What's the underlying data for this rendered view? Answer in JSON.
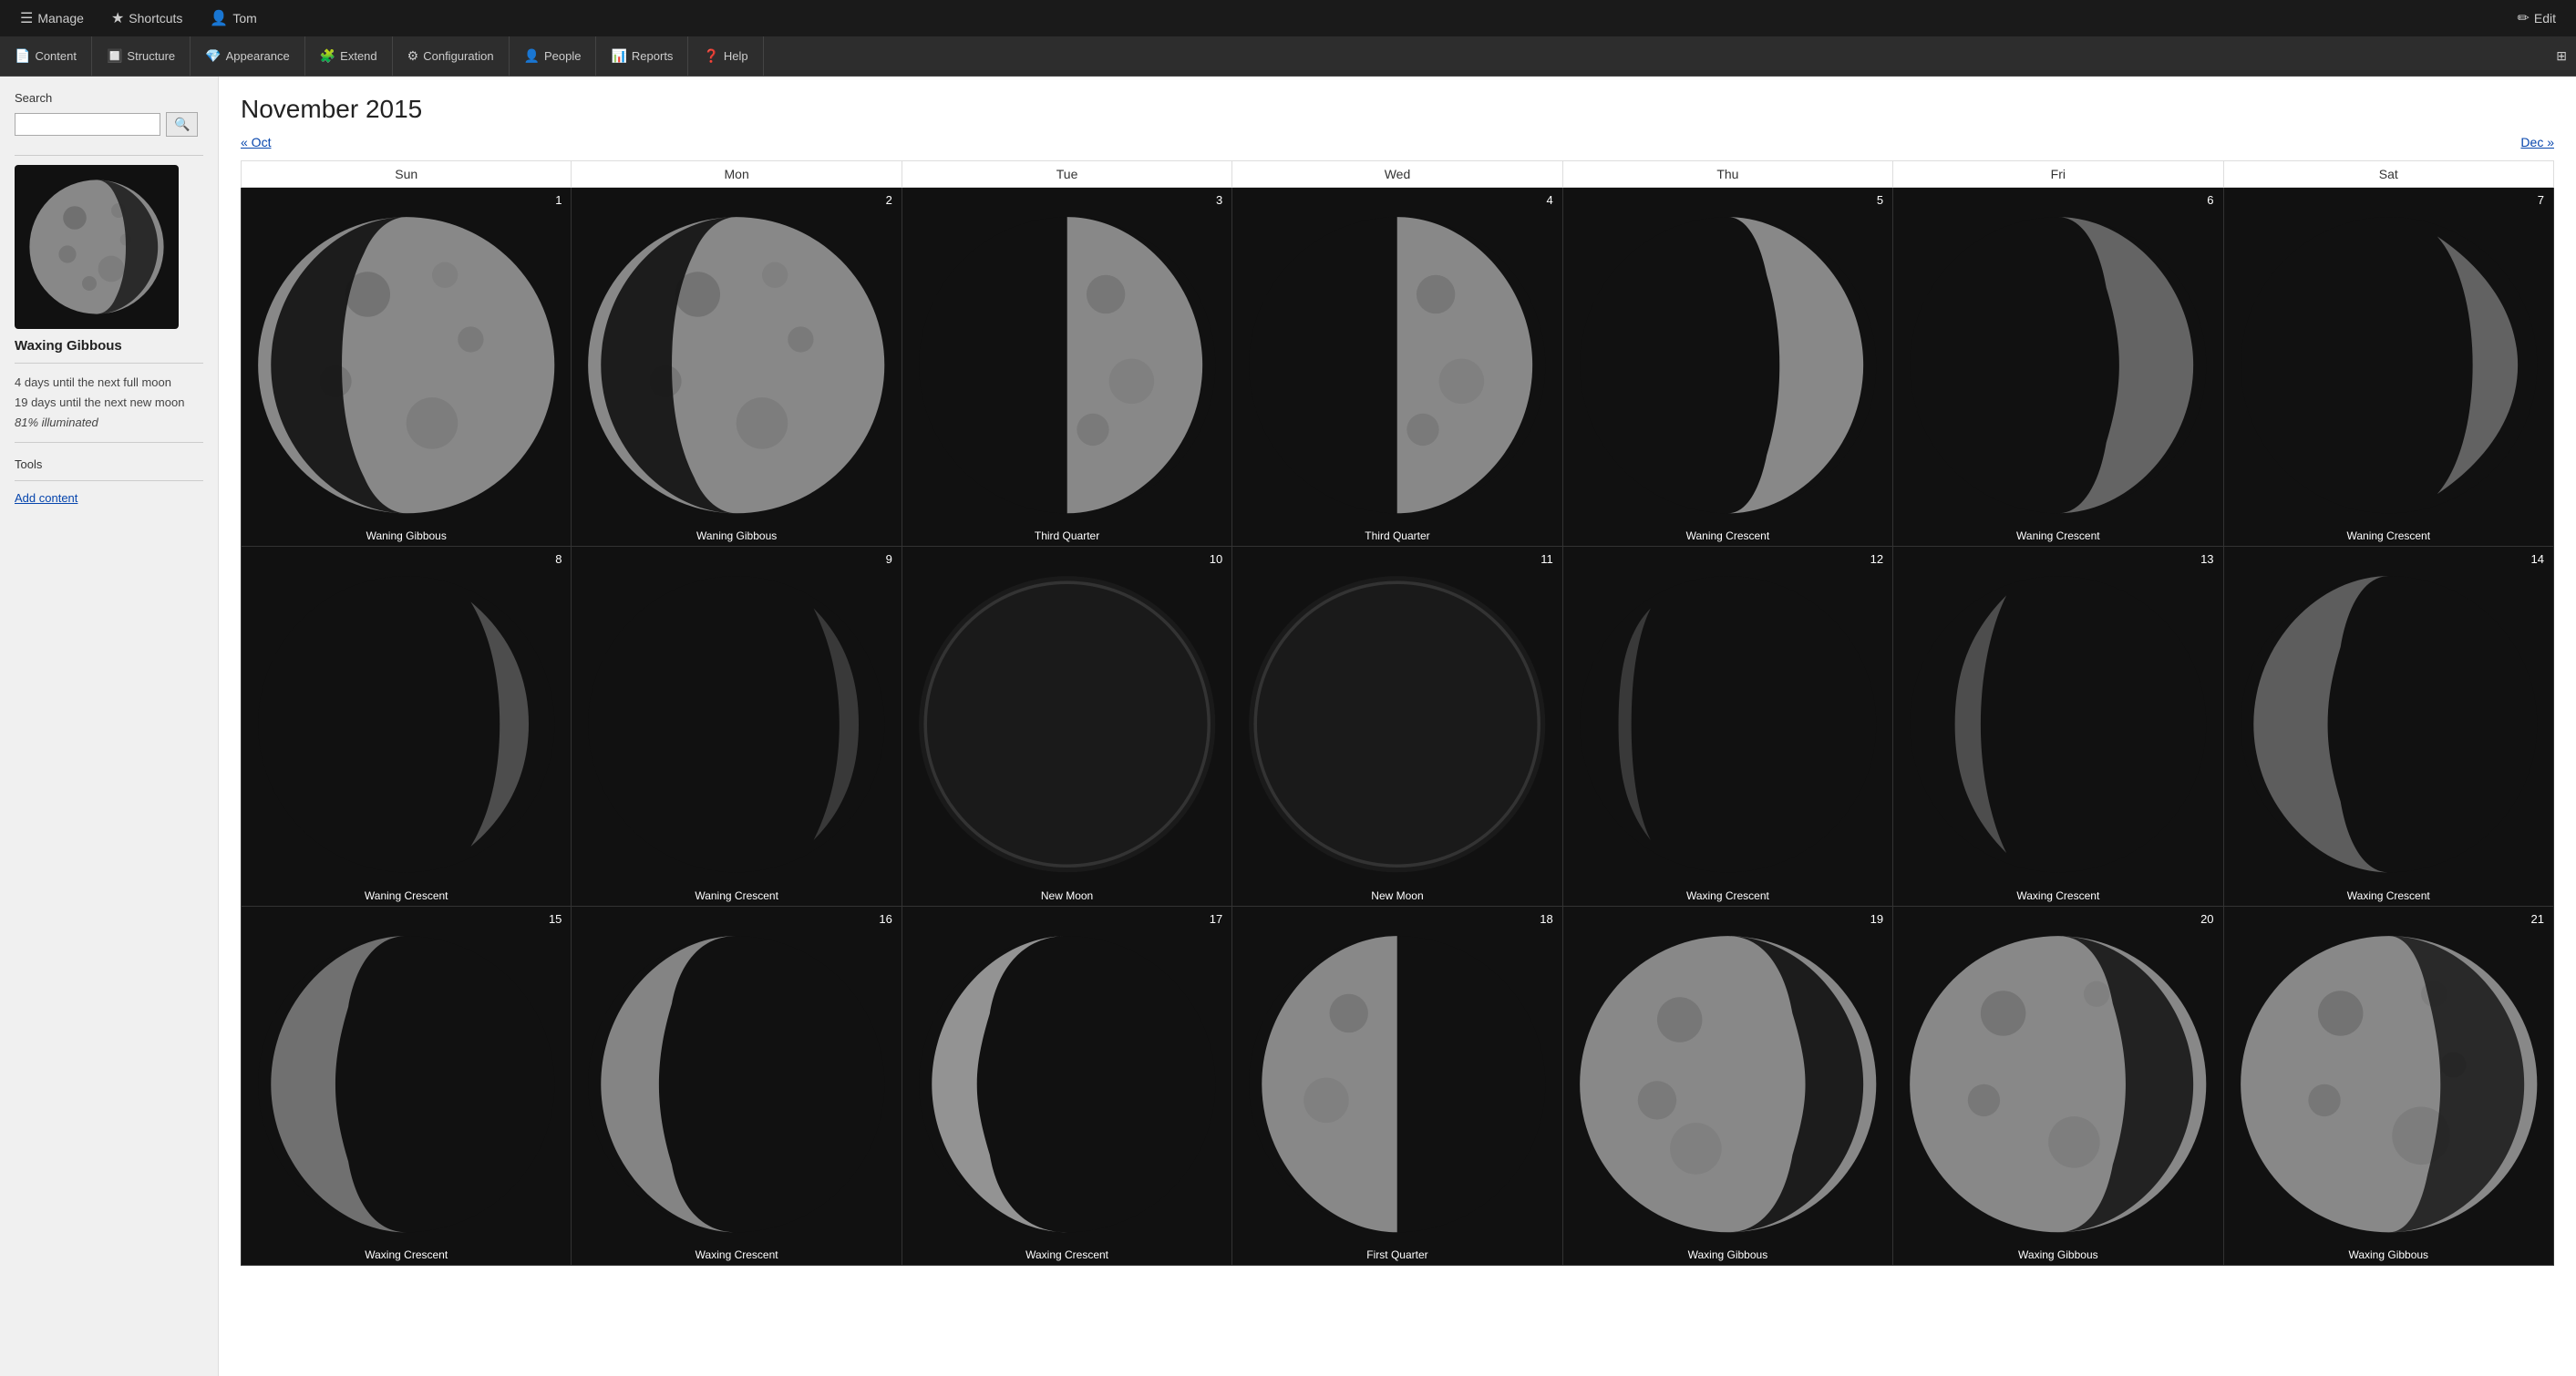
{
  "topNav": {
    "manage": "Manage",
    "shortcuts": "Shortcuts",
    "user": "Tom",
    "edit": "Edit"
  },
  "secNav": {
    "items": [
      {
        "label": "Content",
        "icon": "📄"
      },
      {
        "label": "Structure",
        "icon": "🔲"
      },
      {
        "label": "Appearance",
        "icon": "💎"
      },
      {
        "label": "Extend",
        "icon": "🧩"
      },
      {
        "label": "Configuration",
        "icon": "⚙"
      },
      {
        "label": "People",
        "icon": "👤"
      },
      {
        "label": "Reports",
        "icon": "📊"
      },
      {
        "label": "Help",
        "icon": "❓"
      }
    ]
  },
  "sidebar": {
    "searchLabel": "Search",
    "searchPlaceholder": "",
    "moonPhaseName": "Waxing Gibbous",
    "moonInfo1": "4 days until the next full moon",
    "moonInfo2": "19 days until the next new moon",
    "moonInfo3": "81% illuminated",
    "toolsLabel": "Tools",
    "addContentLink": "Add content"
  },
  "calendar": {
    "title": "November 2015",
    "prevMonth": "« Oct",
    "nextMonth": "Dec »",
    "headers": [
      "Sun",
      "Mon",
      "Tue",
      "Wed",
      "Thu",
      "Fri",
      "Sat"
    ],
    "days": [
      {
        "num": "1",
        "phase": "Waning Gibbous",
        "type": "waning-gibbous"
      },
      {
        "num": "2",
        "phase": "Waning Gibbous",
        "type": "waning-gibbous"
      },
      {
        "num": "3",
        "phase": "Third Quarter",
        "type": "third-quarter"
      },
      {
        "num": "4",
        "phase": "Third Quarter",
        "type": "third-quarter"
      },
      {
        "num": "5",
        "phase": "Waning Crescent",
        "type": "waning-crescent-lg"
      },
      {
        "num": "6",
        "phase": "Waning Crescent",
        "type": "waning-crescent-md"
      },
      {
        "num": "7",
        "phase": "Waning Crescent",
        "type": "waning-crescent-sm"
      },
      {
        "num": "8",
        "phase": "Waning Crescent",
        "type": "waning-crescent-xs"
      },
      {
        "num": "9",
        "phase": "Waning Crescent",
        "type": "waning-crescent-xs2"
      },
      {
        "num": "10",
        "phase": "New Moon",
        "type": "new-moon"
      },
      {
        "num": "11",
        "phase": "New Moon",
        "type": "new-moon"
      },
      {
        "num": "12",
        "phase": "Waxing Crescent",
        "type": "waxing-crescent-xs"
      },
      {
        "num": "13",
        "phase": "Waxing Crescent",
        "type": "waxing-crescent-sm"
      },
      {
        "num": "14",
        "phase": "Waxing Crescent",
        "type": "waxing-crescent-md"
      },
      {
        "num": "15",
        "phase": "Waxing Crescent",
        "type": "waxing-crescent-md2"
      },
      {
        "num": "16",
        "phase": "Waxing Crescent",
        "type": "waxing-crescent-lg"
      },
      {
        "num": "17",
        "phase": "Waxing Crescent",
        "type": "waxing-crescent-lg2"
      },
      {
        "num": "18",
        "phase": "First Quarter",
        "type": "first-quarter"
      },
      {
        "num": "19",
        "phase": "Waxing Gibbous",
        "type": "waxing-gibbous-sm"
      },
      {
        "num": "20",
        "phase": "Waxing Gibbous",
        "type": "waxing-gibbous-md"
      },
      {
        "num": "21",
        "phase": "Waxing Gibbous",
        "type": "waxing-gibbous-lg"
      }
    ]
  }
}
